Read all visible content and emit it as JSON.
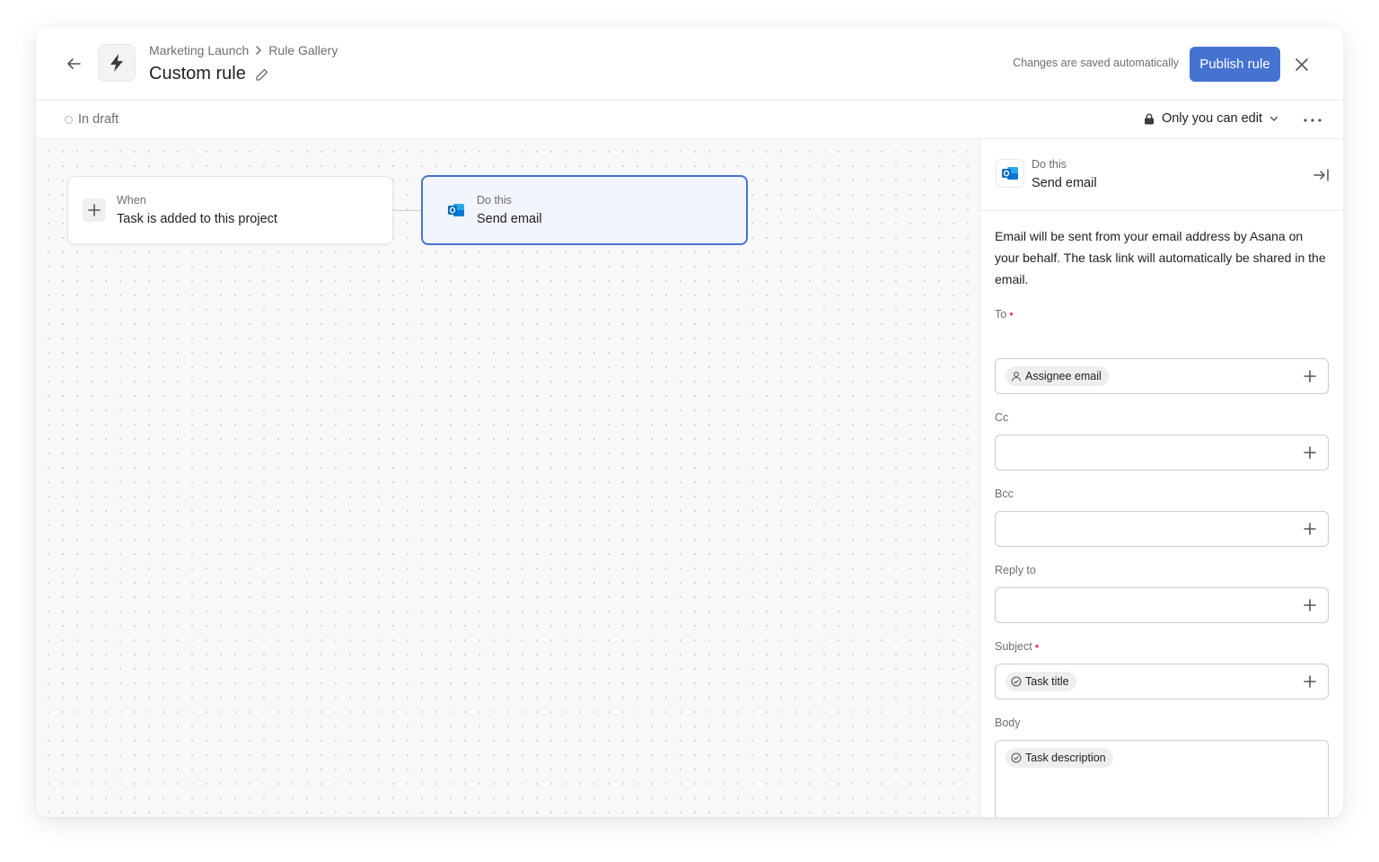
{
  "header": {
    "breadcrumb": [
      "Marketing Launch",
      "Rule Gallery"
    ],
    "title": "Custom rule",
    "autosave_text": "Changes are saved automatically",
    "publish_label": "Publish rule"
  },
  "subbar": {
    "status": "In draft",
    "permission": "Only you can edit"
  },
  "canvas": {
    "trigger": {
      "label": "When",
      "value": "Task is added to this project"
    },
    "action": {
      "label": "Do this",
      "value": "Send email"
    }
  },
  "panel": {
    "header_label": "Do this",
    "header_value": "Send email",
    "description": "Email will be sent from your email address by Asana on your behalf. The task link will automatically be shared in the email.",
    "fields": {
      "to": {
        "label": "To",
        "required": true,
        "chip": "Assignee email"
      },
      "cc": {
        "label": "Cc"
      },
      "bcc": {
        "label": "Bcc"
      },
      "reply_to": {
        "label": "Reply to"
      },
      "subject": {
        "label": "Subject",
        "required": true,
        "chip": "Task title"
      },
      "body": {
        "label": "Body",
        "chip": "Task description"
      }
    }
  },
  "colors": {
    "accent": "#4573d2",
    "required": "#e8384f",
    "outlook": "#0f6cbd"
  },
  "icons": [
    "back-arrow-icon",
    "lightning-icon",
    "chevron-right-icon",
    "pencil-icon",
    "close-icon",
    "lock-icon",
    "chevron-down-icon",
    "more-icon",
    "plus-icon",
    "outlook-icon",
    "collapse-panel-icon",
    "person-icon",
    "check-circle-icon"
  ]
}
